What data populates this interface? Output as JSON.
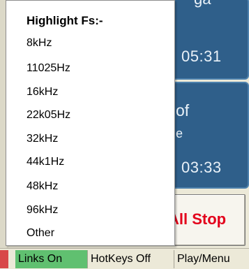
{
  "tiles": [
    {
      "title": "ga",
      "time": "05:31"
    },
    {
      "title": "of",
      "subtitle": "e",
      "time": "03:33"
    }
  ],
  "all_stop": {
    "label": "All Stop"
  },
  "status_bar": {
    "links": "Links On",
    "hotkeys": "HotKeys Off",
    "play_menu": "Play/Menu"
  },
  "menu": {
    "header": "Highlight Fs:-",
    "items": [
      "8kHz",
      "11025Hz",
      "16kHz",
      "22k05Hz",
      "32kHz",
      "44k1Hz",
      "48kHz",
      "96kHz",
      "Other"
    ]
  },
  "colors": {
    "tile_bg": "#2f5f8a",
    "all_stop_text": "#e3001b",
    "links_on_bg": "#60c070",
    "status_red": "#d84848"
  }
}
